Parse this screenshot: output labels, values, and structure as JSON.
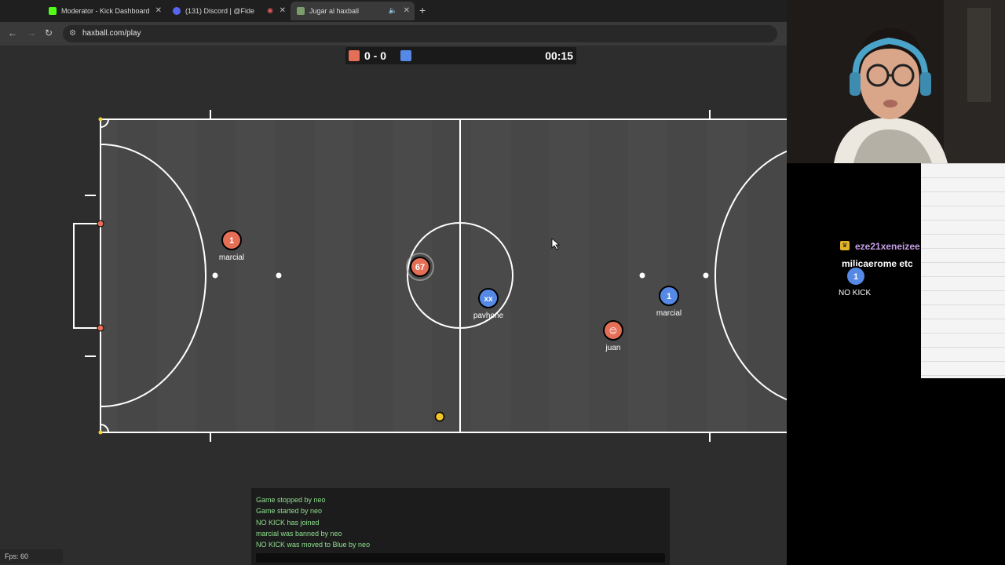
{
  "tabs": [
    {
      "label": "Moderator - Kick Dashboard",
      "icon": "kick-icon",
      "color": "#53fc18"
    },
    {
      "label": "(131) Discord | @Fide",
      "icon": "discord-icon",
      "color": "#5865f2"
    },
    {
      "label": "Jugar al haxball",
      "icon": "haxball-icon",
      "color": "#7a9e6a"
    }
  ],
  "toolbar": {
    "url": "haxball.com/play"
  },
  "scoreboard": {
    "score": "0 - 0",
    "time": "00:15",
    "red_color": "#e56e56",
    "blue_color": "#5689e5"
  },
  "players": [
    {
      "label": "1",
      "name": "marcial",
      "team": "red"
    },
    {
      "label": "67",
      "name": "",
      "team": "red"
    },
    {
      "label": "xx",
      "name": "pavhone",
      "team": "blue"
    },
    {
      "label": "😊",
      "name": "juan",
      "team": "red"
    },
    {
      "label": "1",
      "name": "marcial",
      "team": "blue"
    },
    {
      "label": "1",
      "name": "NO KICK",
      "team": "blue"
    }
  ],
  "chat": {
    "lines": [
      "Game stopped by neo",
      "Game started by neo",
      "NO KICK has joined",
      "marcial was banned by neo",
      "NO KICK was moved to Blue by neo"
    ]
  },
  "fps": "Fps: 60",
  "stream_overlay": {
    "user": "eze21xeneizee",
    "message": "milicaerome etc"
  }
}
